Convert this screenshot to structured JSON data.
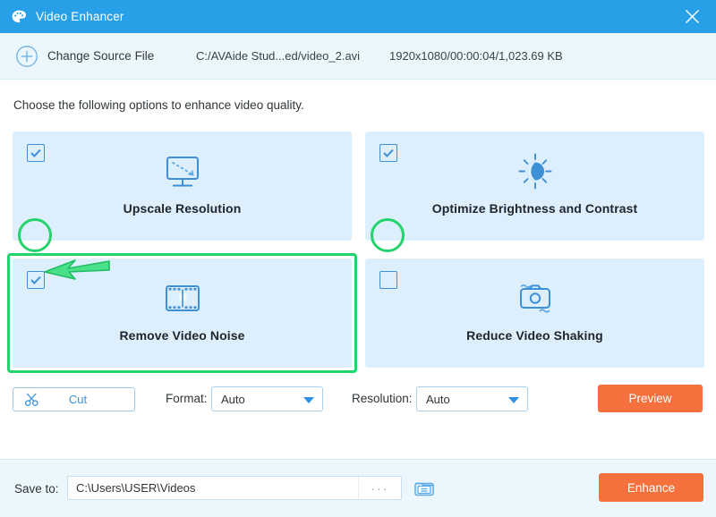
{
  "window": {
    "title": "Video Enhancer",
    "app_icon": "palette-icon",
    "close_icon": "close-icon",
    "titlebar_color": "#28a0e8"
  },
  "header": {
    "add_icon": "plus-circle-icon",
    "change_source_label": "Change Source File",
    "file_path": "C:/AVAide Stud...ed/video_2.avi",
    "file_meta": "1920x1080/00:00:04/1,023.69 KB"
  },
  "main": {
    "instruction": "Choose the following options to enhance video quality.",
    "options": [
      {
        "label": "Upscale Resolution",
        "icon": "monitor-upscale-icon",
        "checked": true,
        "annotated_circle": true,
        "highlighted": false
      },
      {
        "label": "Optimize Brightness and Contrast",
        "icon": "brightness-sun-icon",
        "checked": true,
        "annotated_circle": true,
        "highlighted": false
      },
      {
        "label": "Remove Video Noise",
        "icon": "film-strip-icon",
        "checked": true,
        "annotated_circle": false,
        "highlighted": true
      },
      {
        "label": "Reduce Video Shaking",
        "icon": "camera-stabilize-icon",
        "checked": false,
        "annotated_circle": false,
        "highlighted": false
      }
    ]
  },
  "controls": {
    "cut_label": "Cut",
    "cut_icon": "scissors-icon",
    "format_label": "Format:",
    "format_value": "Auto",
    "resolution_label": "Resolution:",
    "resolution_value": "Auto",
    "preview_label": "Preview",
    "dropdown_icon": "chevron-down-icon"
  },
  "footer": {
    "save_to_label": "Save to:",
    "save_path": "C:\\Users\\USER\\Videos",
    "browse_label": "···",
    "folder_icon": "folder-open-icon",
    "enhance_label": "Enhance"
  },
  "colors": {
    "accent_blue": "#28a0e8",
    "card_blue": "#ddeffc",
    "action_orange": "#f4703c",
    "annotation_green": "#22d46b"
  }
}
